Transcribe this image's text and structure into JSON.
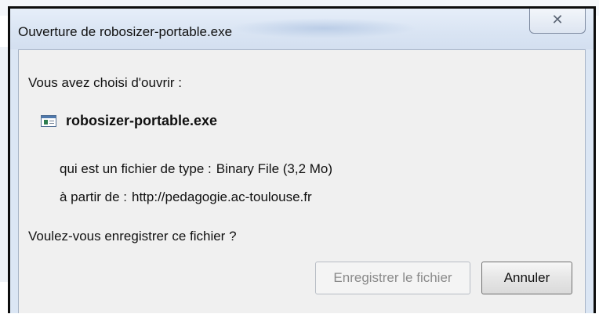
{
  "window": {
    "title": "Ouverture de robosizer-portable.exe",
    "close_glyph": "✕"
  },
  "dialog": {
    "intro": "Vous avez choisi d'ouvrir :",
    "file_name": "robosizer-portable.exe",
    "file_icon": "binary-file-icon",
    "type_label": "qui est un fichier de type :",
    "type_value": "Binary File (3,2 Mo)",
    "from_label": "à partir de :",
    "from_value": "http://pedagogie.ac-toulouse.fr",
    "question": "Voulez-vous enregistrer ce fichier ?"
  },
  "buttons": {
    "save_label": "Enregistrer le fichier",
    "save_enabled": false,
    "cancel_label": "Annuler"
  },
  "colors": {
    "titlebar": "#dbe6f4",
    "content_bg": "#f0f0f0",
    "disabled_text": "#8a8a8a"
  }
}
